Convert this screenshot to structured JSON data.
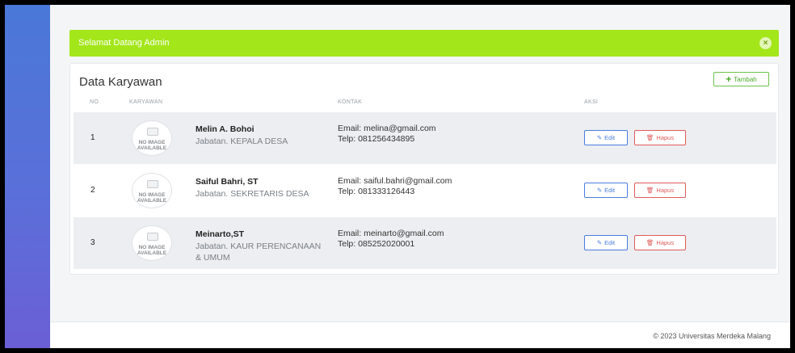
{
  "alert": {
    "text": "Selamat Datang Admin",
    "close": "×"
  },
  "card": {
    "title": "Data Karyawan",
    "add_label": "Tambah",
    "columns": {
      "no": "NO",
      "employee": "KARYAWAN",
      "contact": "KONTAK",
      "action": "AKSI"
    }
  },
  "thumb": {
    "line1": "NO IMAGE",
    "line2": "AVAILABLE"
  },
  "rows": [
    {
      "no": "1",
      "name": "Melin A. Bohoi",
      "jabatan": "Jabatan. KEPALA DESA",
      "email": "Email: melina@gmail.com",
      "telp": "Telp: 081256434895",
      "edit": "Edit",
      "delete": "Hapus"
    },
    {
      "no": "2",
      "name": "Saiful Bahri, ST",
      "jabatan": "Jabatan. SEKRETARIS DESA",
      "email": "Email: saiful.bahri@gmail.com",
      "telp": "Telp: 081333126443",
      "edit": "Edit",
      "delete": "Hapus"
    },
    {
      "no": "3",
      "name": "Meinarto,ST",
      "jabatan": "Jabatan. KAUR PERENCANAAN & UMUM",
      "email": "Email: meinarto@gmail.com",
      "telp": "Telp: 085252020001",
      "edit": "Edit",
      "delete": "Hapus"
    }
  ],
  "footer": {
    "text": "© 2023 Universitas Merdeka Malang"
  },
  "colors": {
    "alert": "#a3e61a",
    "edit": "#4a7de0",
    "delete": "#e05a5a",
    "add": "#6cc04a"
  }
}
